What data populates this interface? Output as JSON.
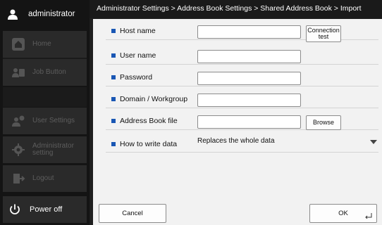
{
  "user": {
    "name": "administrator",
    "icon": "user-icon"
  },
  "breadcrumb": "Administrator Settings > Address Book Settings > Shared Address Book > Import",
  "sidebar": {
    "items": [
      {
        "label": "Home",
        "icon": "home-icon"
      },
      {
        "label": "Job Button",
        "icon": "job-button-icon"
      },
      {
        "label": "User Settings",
        "icon": "user-settings-icon"
      },
      {
        "label": "Administrator setting",
        "icon": "gear-icon"
      },
      {
        "label": "Logout",
        "icon": "logout-icon"
      }
    ],
    "power_label": "Power off"
  },
  "form": {
    "host_name_label": "Host name",
    "connection_test_label": "Connection test",
    "user_name_label": "User name",
    "password_label": "Password",
    "domain_label": "Domain / Workgroup",
    "address_book_file_label": "Address Book file",
    "browse_label": "Browse",
    "write_mode_label": "How to write data",
    "write_mode_value": "Replaces the whole data"
  },
  "buttons": {
    "cancel_label": "Cancel",
    "ok_label": "OK"
  },
  "colors": {
    "bullet": "#1a57b4",
    "panel": "#f2f2f2",
    "sidebar": "#141414"
  }
}
